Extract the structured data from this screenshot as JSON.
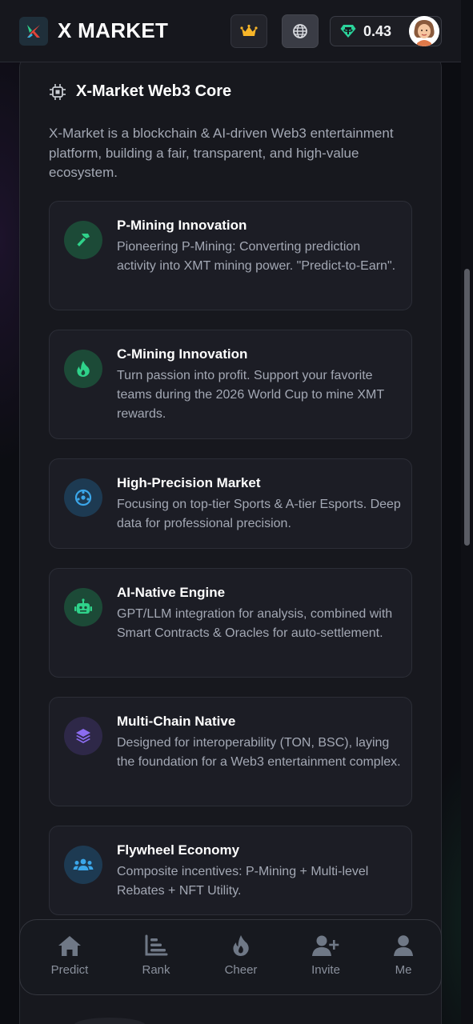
{
  "header": {
    "brand": "X MARKET",
    "balance": "0.43",
    "icons": {
      "logo": "x-logo-icon",
      "crown": "crown-icon",
      "globe": "globe-icon",
      "tether": "tether-icon",
      "avatar": "avatar"
    }
  },
  "section": {
    "title": "X-Market Web3 Core",
    "title_icon": "chip-icon",
    "description": "X-Market is a blockchain & AI-driven Web3 entertainment platform, building a fair, transparent, and high-value ecosystem."
  },
  "features": [
    {
      "title": "P-Mining Innovation",
      "desc": "Pioneering P-Mining: Converting prediction activity into XMT mining power. \"Predict-to-Earn\".",
      "icon": "hammer-icon",
      "color": "#2fd28a"
    },
    {
      "title": "C-Mining Innovation",
      "desc": "Turn passion into profit. Support your favorite teams during the 2026 World Cup to mine XMT rewards.",
      "icon": "fire-icon",
      "color": "#2fd28a"
    },
    {
      "title": "High-Precision Market",
      "desc": "Focusing on top-tier Sports & A-tier Esports. Deep data for professional precision.",
      "icon": "soccer-ball-icon",
      "color": "#3ba7ea"
    },
    {
      "title": "AI-Native Engine",
      "desc": "GPT/LLM integration for analysis, combined with Smart Contracts & Oracles for auto-settlement.",
      "icon": "robot-icon",
      "color": "#2fd28a"
    },
    {
      "title": "Multi-Chain Native",
      "desc": "Designed for interoperability (TON, BSC), laying the foundation for a Web3 entertainment complex.",
      "icon": "layers-icon",
      "color": "#8b6cf0"
    },
    {
      "title": "Flywheel Economy",
      "desc": "Composite incentives: P-Mining + Multi-level Rebates + NFT Utility.",
      "icon": "users-icon",
      "color": "#3ba7ea"
    }
  ],
  "nav": [
    {
      "label": "Predict",
      "icon": "home-icon"
    },
    {
      "label": "Rank",
      "icon": "bar-chart-icon"
    },
    {
      "label": "Cheer",
      "icon": "fire-icon"
    },
    {
      "label": "Invite",
      "icon": "user-plus-icon"
    },
    {
      "label": "Me",
      "icon": "user-icon"
    }
  ]
}
